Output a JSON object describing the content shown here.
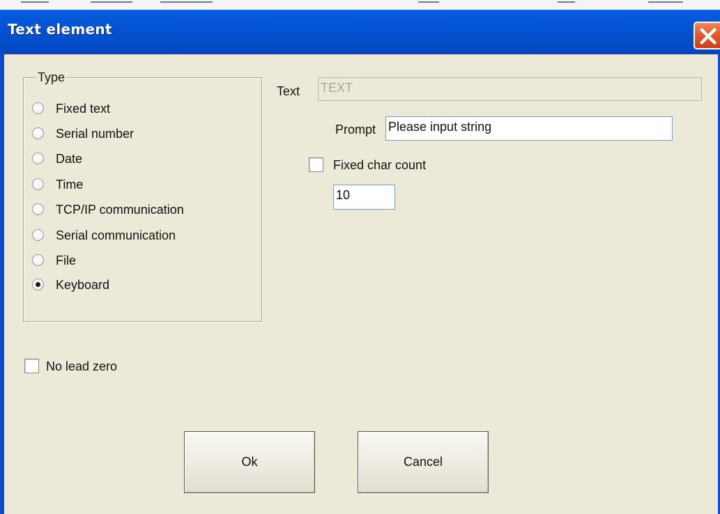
{
  "window": {
    "title": "Text element"
  },
  "type_group": {
    "label": "Type",
    "options": [
      {
        "label": "Fixed text",
        "selected": false
      },
      {
        "label": "Serial number",
        "selected": false
      },
      {
        "label": "Date",
        "selected": false
      },
      {
        "label": "Time",
        "selected": false
      },
      {
        "label": "TCP/IP communication",
        "selected": false
      },
      {
        "label": "Serial communication",
        "selected": false
      },
      {
        "label": "File",
        "selected": false
      },
      {
        "label": "Keyboard",
        "selected": true
      }
    ]
  },
  "text_field": {
    "label": "Text",
    "value": "TEXT",
    "enabled": false
  },
  "prompt_field": {
    "label": "Prompt",
    "value": "Please input string"
  },
  "fixed_char_count": {
    "label": "Fixed char count",
    "checked": false,
    "value": "10"
  },
  "no_lead_zero": {
    "label": "No lead zero",
    "checked": false
  },
  "buttons": {
    "ok_label": "Ok",
    "cancel_label": "Cancel"
  },
  "colors": {
    "titlebar": "#0350cf",
    "dialog_background": "#ece9d8",
    "close_button": "#e65b2e"
  }
}
